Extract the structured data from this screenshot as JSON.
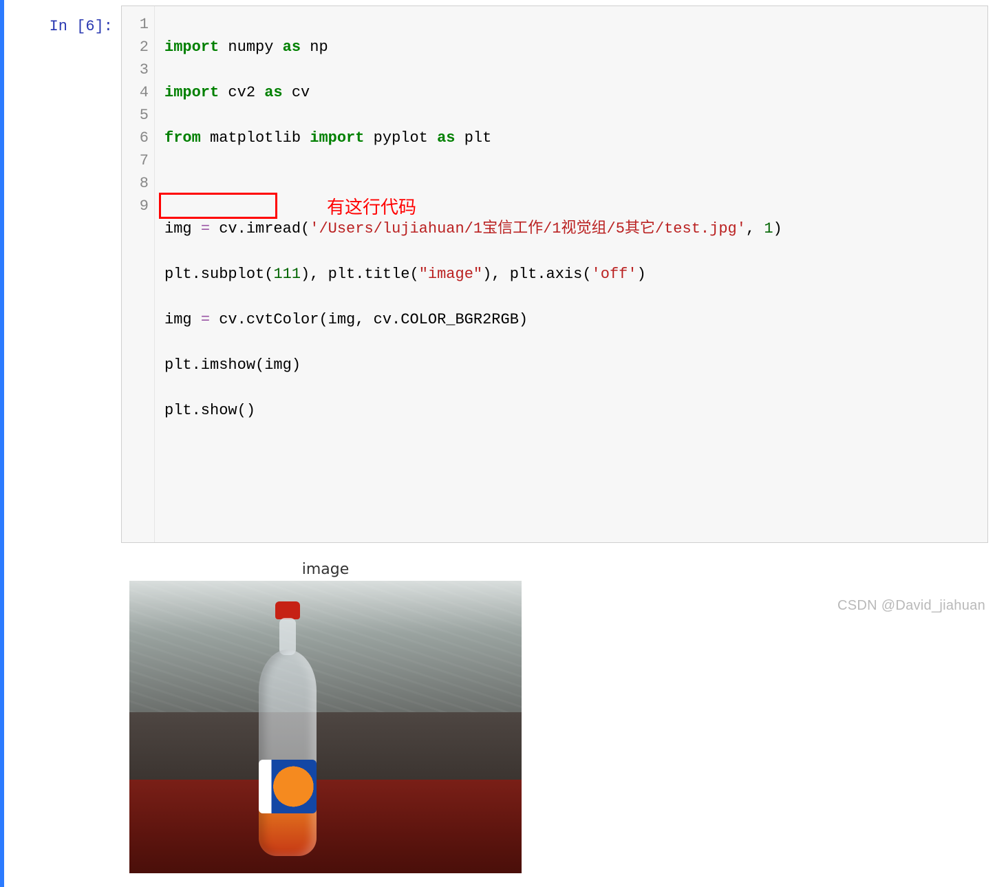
{
  "cell": {
    "prompt": "In [6]:",
    "gutter": [
      "1",
      "2",
      "3",
      "4",
      "5",
      "6",
      "7",
      "8",
      "9"
    ],
    "code": {
      "l1": {
        "kw1": "import",
        "mod": "numpy",
        "kw2": "as",
        "alias": "np"
      },
      "l2": {
        "kw1": "import",
        "mod": "cv2",
        "kw2": "as",
        "alias": "cv"
      },
      "l3": {
        "kw1": "from",
        "mod": "matplotlib",
        "kw2": "import",
        "name": "pyplot",
        "kw3": "as",
        "alias": "plt"
      },
      "l4": "",
      "l5": {
        "lhs": "img",
        "eq": "=",
        "call": "cv.imread(",
        "str": "'/Users/lujiahuan/1宝信工作/1视觉组/5其它/test.jpg'",
        "comma": ", ",
        "num": "1",
        "close": ")"
      },
      "l6": {
        "a": "plt.subplot(",
        "n": "111",
        "b": "), plt.title(",
        "s1": "\"image\"",
        "c": "), plt.axis(",
        "s2": "'off'",
        "d": ")"
      },
      "l7": {
        "lhs": "img",
        "eq": "=",
        "rest": "cv.cvtColor(img, cv.COLOR_BGR2RGB)"
      },
      "l8": "plt.imshow(img)",
      "l9": "plt.show()"
    },
    "annotation_text": "有这行代码"
  },
  "output": {
    "plot_title": "image"
  },
  "watermark": "CSDN @David_jiahuan"
}
